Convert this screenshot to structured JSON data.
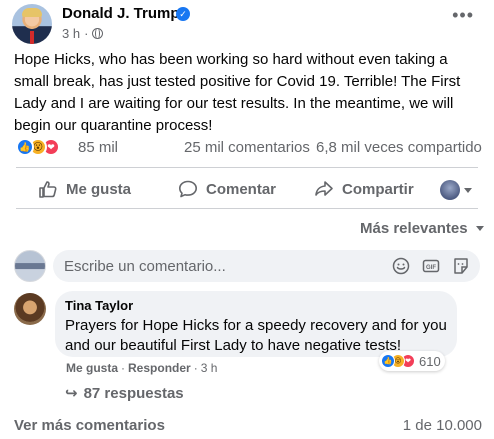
{
  "post": {
    "author": "Donald J. Trump",
    "time": "3 h",
    "text": "Hope Hicks, who has been working so hard without even taking a small break, has just tested positive for Covid 19. Terrible! The First Lady and I are waiting for our test results. In the meantime, we will begin our quarantine process!",
    "reactions_count": "85 mil",
    "comments_count": "25 mil comentarios",
    "shares_count": "6,8 mil veces compartido"
  },
  "actions": {
    "like": "Me gusta",
    "comment": "Comentar",
    "share": "Compartir"
  },
  "sort_label": "Más relevantes",
  "comment_input": {
    "placeholder": "Escribe un comentario..."
  },
  "comment": {
    "author": "Tina Taylor",
    "text": "Prayers for Hope Hicks for a speedy recovery and for you and our beautiful First Lady to have negative tests!",
    "reactions_count": "610",
    "like_label": "Me gusta",
    "separator": "·",
    "reply_label": "Responder",
    "time": "3 h",
    "replies": "87 respuestas"
  },
  "footer": {
    "more_comments": "Ver más comentarios",
    "pager": "1 de 10.000"
  },
  "colors": {
    "accent": "#1877f2",
    "secondary_text": "#65676b",
    "bubble_bg": "#f0f2f5",
    "love": "#f33e58",
    "wow": "#f7b125"
  }
}
